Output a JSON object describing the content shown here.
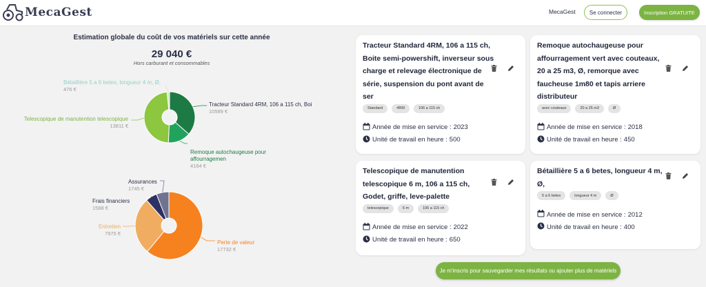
{
  "header": {
    "logo_text": "MecaGest",
    "nav_link": "MecaGest",
    "login_label": "Se connecter",
    "signup_label": "Inscription GRATUITE"
  },
  "summary": {
    "title": "Estimation globale du coût de vos matériels sur cette année",
    "total": "29 040 €",
    "note": "Hors carburant et consommables"
  },
  "chart_data": [
    {
      "type": "pie",
      "variant": "donut",
      "slices": [
        {
          "label": "Tracteur Standard 4RM, 106 a 115 ch, Boi",
          "value_label": "10589 €",
          "value": 10589,
          "color": "#1e7a45"
        },
        {
          "label": "Remoque auto­chaugeuse pour affourragemen",
          "value_label": "4164 €",
          "value": 4164,
          "color": "#21a35e"
        },
        {
          "label": "Telescopique de manutention telescopique",
          "value_label": "13811 €",
          "value": 13811,
          "color": "#8dc63f"
        },
        {
          "label": "Bétaillière 5 a 6 betes, longueur 4 m, Ø,",
          "value_label": "476 €",
          "value": 476,
          "color": "#cfe9c2"
        }
      ]
    },
    {
      "type": "pie",
      "variant": "donut",
      "slices": [
        {
          "label": "Perte de valeur",
          "value_label": "17732 €",
          "value": 17732,
          "color": "#f5821f"
        },
        {
          "label": "Entretien",
          "value_label": "7975 €",
          "value": 7975,
          "color": "#f0ad62"
        },
        {
          "label": "Frais financiers",
          "value_label": "1588 €",
          "value": 1588,
          "color": "#2e3262"
        },
        {
          "label": "Assurances",
          "value_label": "1745 €",
          "value": 1745,
          "color": "#6f7390"
        }
      ]
    }
  ],
  "labels": {
    "year_prefix": "Année de mise en service : ",
    "hours_prefix": "Unité de travail en heure : "
  },
  "cards": [
    {
      "title_lines": [
        "Tracteur Standard 4RM, 106 a 115 ch,",
        "Boite semi-powershift, inverseur sous",
        "charge et relevage électronique de",
        "série, suspension du pont avant de",
        "ser"
      ],
      "tags": [
        "Standard",
        "4RM",
        "106 a 115 ch"
      ],
      "year": "2023",
      "hours": "500"
    },
    {
      "title_lines": [
        "Remoque autochaugeuse pour",
        "affourragement vert avec couteaux,",
        "20 a 25 m3, Ø, remorque avec",
        "faucheuse 1m80 et tapis arriere",
        "distributeur"
      ],
      "tags": [
        "avec couteaux",
        "20 a 25 m3",
        "Ø"
      ],
      "year": "2018",
      "hours": "450"
    },
    {
      "title_lines": [
        "Telescopique de manutention",
        "telescopique 6 m, 106 a 115 ch,",
        "Godet, griffe, leve-palette"
      ],
      "tags": [
        "telescopique",
        "6 m",
        "106 a 115 ch"
      ],
      "year": "2022",
      "hours": "650"
    },
    {
      "title_lines": [
        "Bétaillière 5 a 6 betes, longueur 4 m,",
        "Ø,"
      ],
      "tags": [
        "5 a 6 betes",
        "longueur 4 m",
        "Ø"
      ],
      "year": "2012",
      "hours": "400"
    }
  ],
  "cta_label": "Je m'inscris pour sauvegarder mes résultats ou ajouter plus de matériels",
  "icons": {
    "delete": "trash-icon",
    "edit": "pencil-icon",
    "calendar": "calendar-icon",
    "clock": "clock-icon",
    "logo": "tractor-logo-icon"
  }
}
